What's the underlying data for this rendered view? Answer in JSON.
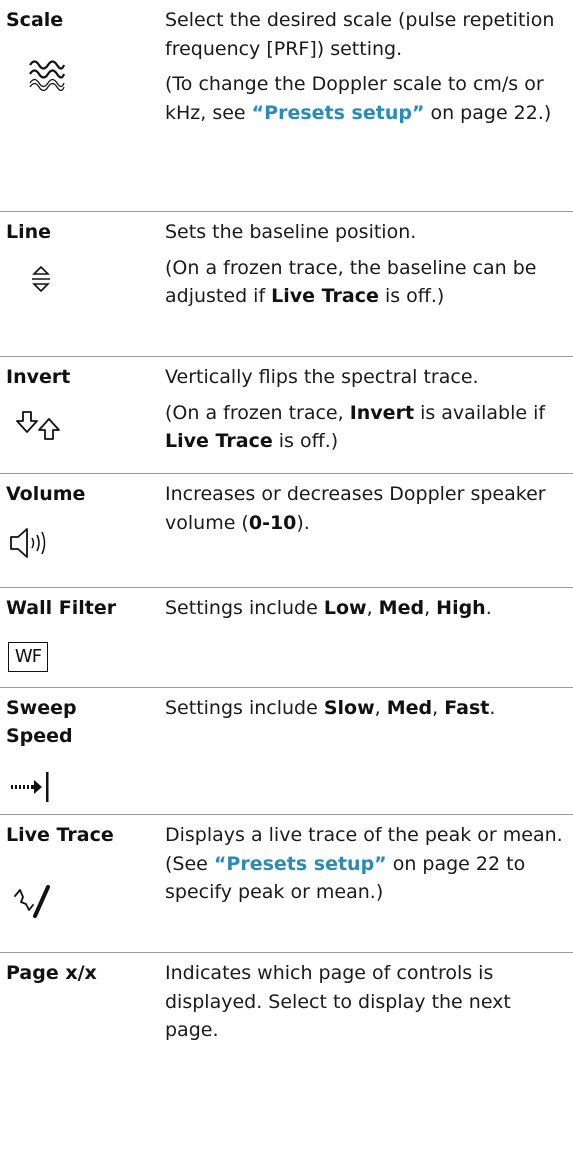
{
  "rows": [
    {
      "control": "Scale",
      "icon": "scale-waves-icon",
      "desc1": "Select the desired scale (pulse repetition frequency [PRF]) setting.",
      "desc2_pre": "(To change the Doppler scale to cm/s or kHz, see ",
      "desc2_link": "“Presets setup”",
      "desc2_post": " on page 22.)"
    },
    {
      "control": "Line",
      "icon": "baseline-arrows-icon",
      "desc1": "Sets the baseline position.",
      "desc2_pre": "(On a frozen trace, the baseline can be adjusted if ",
      "desc2_bold": "Live Trace",
      "desc2_post": " is off.)"
    },
    {
      "control": "Invert",
      "icon": "invert-arrows-icon",
      "desc1": "Vertically flips the spectral trace.",
      "desc2_pre": "(On a frozen trace, ",
      "desc2_bold1": "Invert",
      "desc2_mid": " is available if ",
      "desc2_bold2": "Live Trace",
      "desc2_post": " is off.)"
    },
    {
      "control": "Volume",
      "icon": "speaker-volume-icon",
      "desc_pre": "Increases or decreases Doppler speaker volume (",
      "desc_bold": "0-10",
      "desc_post": ")."
    },
    {
      "control": "Wall Filter",
      "icon": "wall-filter-icon",
      "icon_text": "WF",
      "desc_pre": "Settings include ",
      "opt1": "Low",
      "opt2": "Med",
      "opt3": "High",
      "sep": ", ",
      "end": "."
    },
    {
      "control": "Sweep Speed",
      "icon": "sweep-speed-icon",
      "desc_pre": "Settings include ",
      "opt1": "Slow",
      "opt2": "Med",
      "opt3": "Fast",
      "sep": ", ",
      "end": "."
    },
    {
      "control": "Live Trace",
      "icon": "live-trace-icon",
      "desc_pre": "Displays a live trace of the peak or mean. (See ",
      "desc_link": "“Presets setup”",
      "desc_post": " on page 22 to specify peak or mean.)"
    },
    {
      "control": "Page x/x",
      "desc": "Indicates which page of controls is displayed. Select to display the next page."
    }
  ]
}
